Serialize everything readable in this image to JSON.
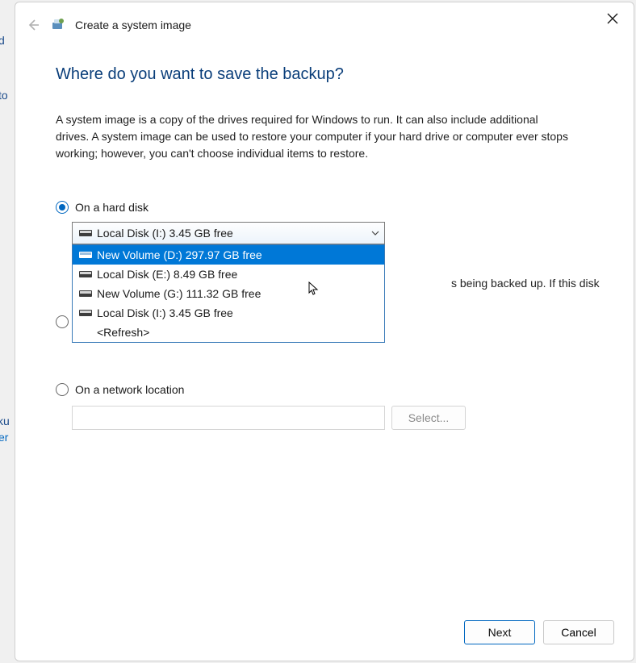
{
  "bg": {
    "line1": "d",
    "line2": "to",
    "line3": "cku",
    "line4": "er"
  },
  "header": {
    "title": "Create a system image"
  },
  "main": {
    "heading": "Where do you want to save the backup?",
    "description": "A system image is a copy of the drives required for Windows to run. It can also include additional drives. A system image can be used to restore your computer if your hard drive or computer ever stops working; however, you can't choose individual items to restore."
  },
  "options": {
    "hard_disk": {
      "label": "On a hard disk",
      "selected": true,
      "combo_selected": "Local Disk (I:)  3.45 GB free",
      "hint_suffix": "s being backed up. If this disk",
      "dropdown": {
        "item0": "New Volume (D:)  297.97 GB free",
        "item1": "Local Disk (E:)  8.49 GB free",
        "item2": "New Volume (G:)  111.32 GB free",
        "item3": "Local Disk (I:)  3.45 GB free",
        "refresh": "<Refresh>"
      }
    },
    "dvd": {
      "selected": false
    },
    "network": {
      "label": "On a network location",
      "selected": false,
      "select_button": "Select..."
    }
  },
  "footer": {
    "next": "Next",
    "cancel": "Cancel"
  }
}
